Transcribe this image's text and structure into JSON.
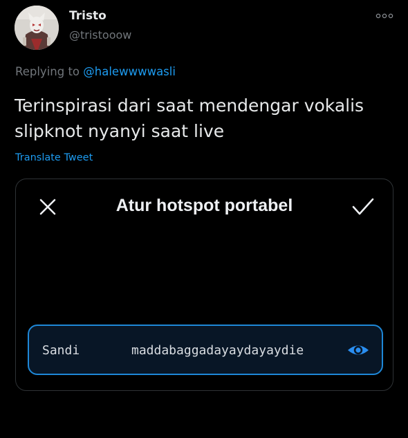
{
  "tweet": {
    "author": {
      "display_name": "Tristo",
      "handle": "@tristooow",
      "avatar_icon": "profile-photo"
    },
    "more_icon": "more-horizontal-icon",
    "replying_prefix": "Replying to ",
    "replying_to": "@halewwwwasli",
    "text": "Terinspirasi dari saat mendengar vokalis slipknot nyanyi saat live",
    "translate_label": "Translate Tweet"
  },
  "media": {
    "dialog_title": "Atur hotspot portabel",
    "close_icon": "close-icon",
    "confirm_icon": "checkmark-icon",
    "password_field": {
      "label": "Sandi",
      "value": "maddabaggadayaydayaydie",
      "toggle_icon": "eye-icon"
    }
  },
  "colors": {
    "background": "#000000",
    "primary_text": "#e7e9ea",
    "secondary_text": "#71767b",
    "link": "#1d9bf0",
    "field_border": "#1e88d8",
    "field_background": "#081626"
  }
}
